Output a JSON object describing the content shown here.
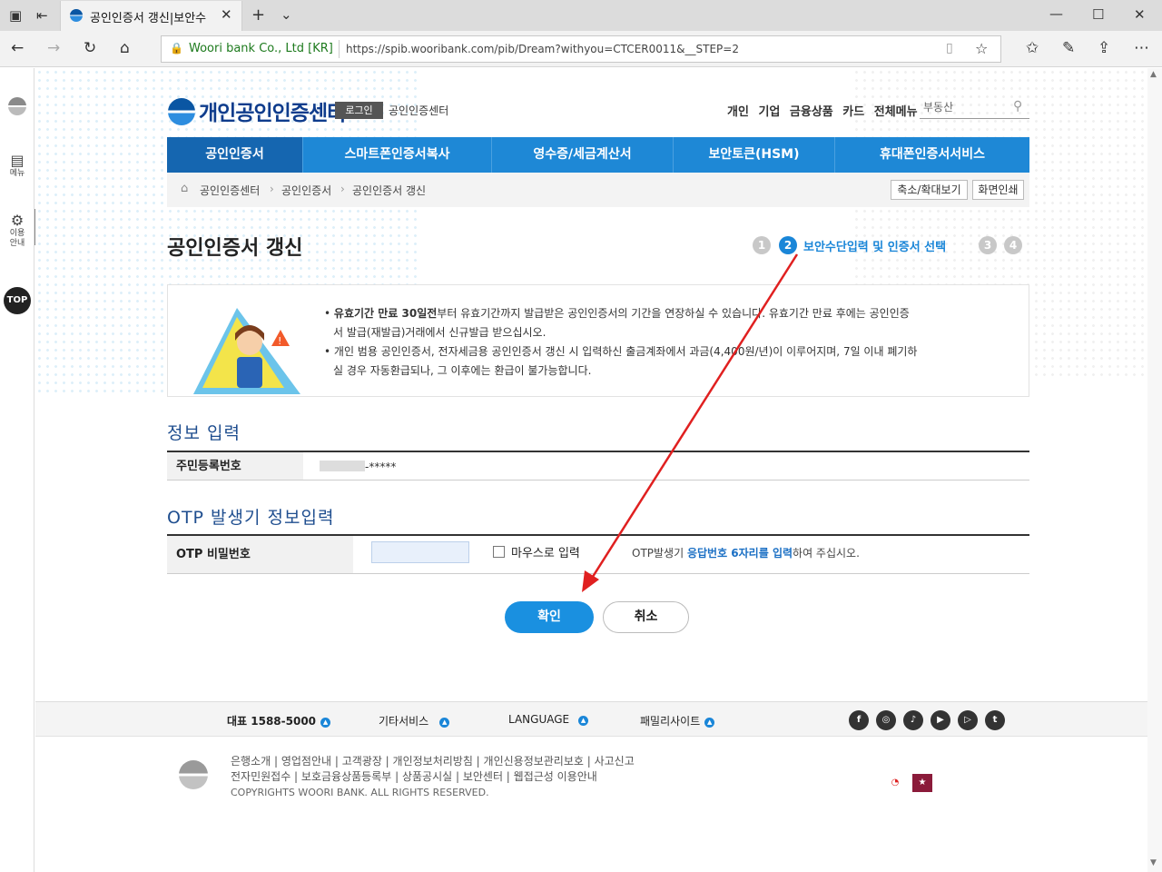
{
  "browser": {
    "tab_title": "공인인증서 갱신|보안수",
    "cert_label": "Woori bank Co., Ltd [KR]",
    "url": "https://spib.wooribank.com/pib/Dream?withyou=CTCER0011&__STEP=2"
  },
  "sidepanel": {
    "menu_label": "메뉴",
    "guide_label_1": "이용",
    "guide_label_2": "안내",
    "top_label": "TOP"
  },
  "header": {
    "logo_text": "개인공인인증센터",
    "login_label": "로그인",
    "center_label": "공인인증센터",
    "top_menu": [
      "개인",
      "기업",
      "금융상품",
      "카드",
      "전체메뉴"
    ],
    "search_placeholder": "부동산"
  },
  "gnb": [
    "공인인증서",
    "스마트폰인증서복사",
    "영수증/세금계산서",
    "보안토큰(HSM)",
    "휴대폰인증서서비스"
  ],
  "breadcrumb": {
    "items": [
      "공인인증센터",
      "공인인증서",
      "공인인증서 갱신"
    ],
    "zoom_label": "축소/확대보기",
    "print_label": "화면인쇄"
  },
  "page": {
    "title": "공인인증서 갱신",
    "steps": [
      "1",
      "2",
      "3",
      "4"
    ],
    "current_step_label": "보안수단입력 및 인증서 선택"
  },
  "notice": {
    "line1_bold": "유효기간 만료 30일전",
    "line1_rest": "부터 유효기간까지 발급받은 공인인증서의 기간을 연장하실 수 있습니다. 유효기간 만료 후에는 공인인증",
    "line2": "서 발급(재발급)거래에서 신규발급 받으십시오.",
    "line3": "개인 범용 공인인증서, 전자세금용 공인인증서 갱신 시 입력하신 출금계좌에서 과금(4,400원/년)이 이루어지며, 7일 이내 폐기하",
    "line4": "실 경우 자동환급되나, 그 이후에는 환급이 불가능합니다."
  },
  "info_section": {
    "title": "정보 입력",
    "rrn_label": "주민등록번호",
    "rrn_value": "-*****"
  },
  "otp_section": {
    "title": "OTP 발생기 정보입력",
    "pw_label": "OTP 비밀번호",
    "mouse_input_label": "마우스로 입력",
    "help_prefix": "OTP발생기 ",
    "help_bold": "응답번호 6자리를 입력",
    "help_suffix": "하여 주십시오."
  },
  "buttons": {
    "confirm": "확인",
    "cancel": "취소"
  },
  "footer": {
    "rep_phone": "대표 1588-5000",
    "other_services": "기타서비스",
    "language": "LANGUAGE",
    "family_sites": "패밀리사이트",
    "links_row1": "은행소개 | 영업점안내 | 고객광장 | 개인정보처리방침 | 개인신용정보관리보호 | 사고신고",
    "links_row2": "전자민원접수 | 보호금융상품등록부 | 상품공시실 | 보안센터 | 웹접근성 이용안내",
    "copyright": "COPYRIGHTS WOORI BANK. ALL RIGHTS RESERVED.",
    "sns_icons": [
      "facebook-icon",
      "instagram-icon",
      "podcast-icon",
      "youtube-icon",
      "play-icon",
      "twitter-icon"
    ]
  },
  "colors": {
    "brand_blue": "#1e88d6",
    "dark_blue": "#1566b0",
    "annotation_arrow": "#e02020"
  }
}
